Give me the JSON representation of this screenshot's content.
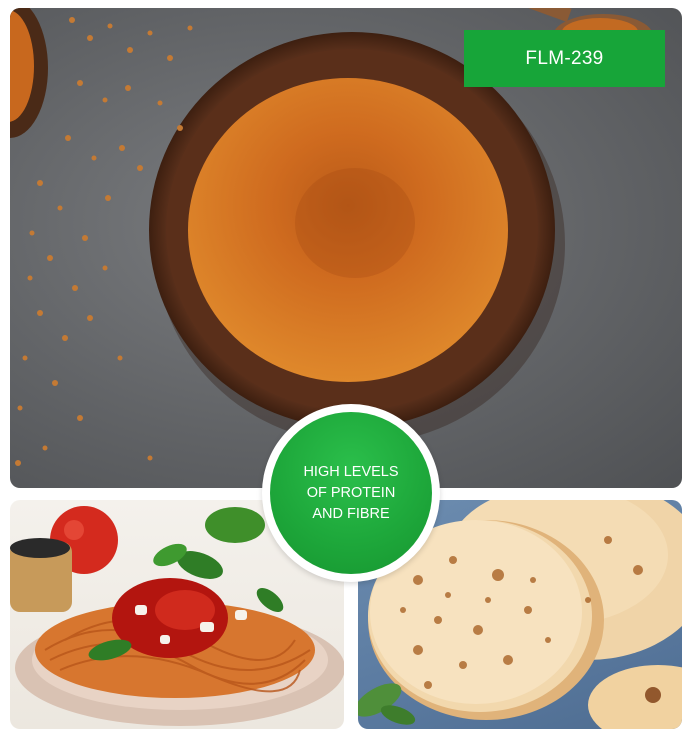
{
  "product_code": "FLM-239",
  "claim": {
    "line1": "HIGH LEVELS",
    "line2": "OF PROTEIN",
    "line3": "AND FIBRE"
  },
  "images": {
    "top": "wooden-bowl-of-orange-spice-powder-with-scattered-seeds",
    "bottom_left": "spaghetti-with-tomato-sauce-and-basil",
    "bottom_right": "stack-of-flatbread-tortillas"
  },
  "colors": {
    "badge_green": "#17a539",
    "claim_green": "#1ea83b",
    "powder_orange": "#c9661c",
    "bowl_brown": "#5a2f1a"
  }
}
